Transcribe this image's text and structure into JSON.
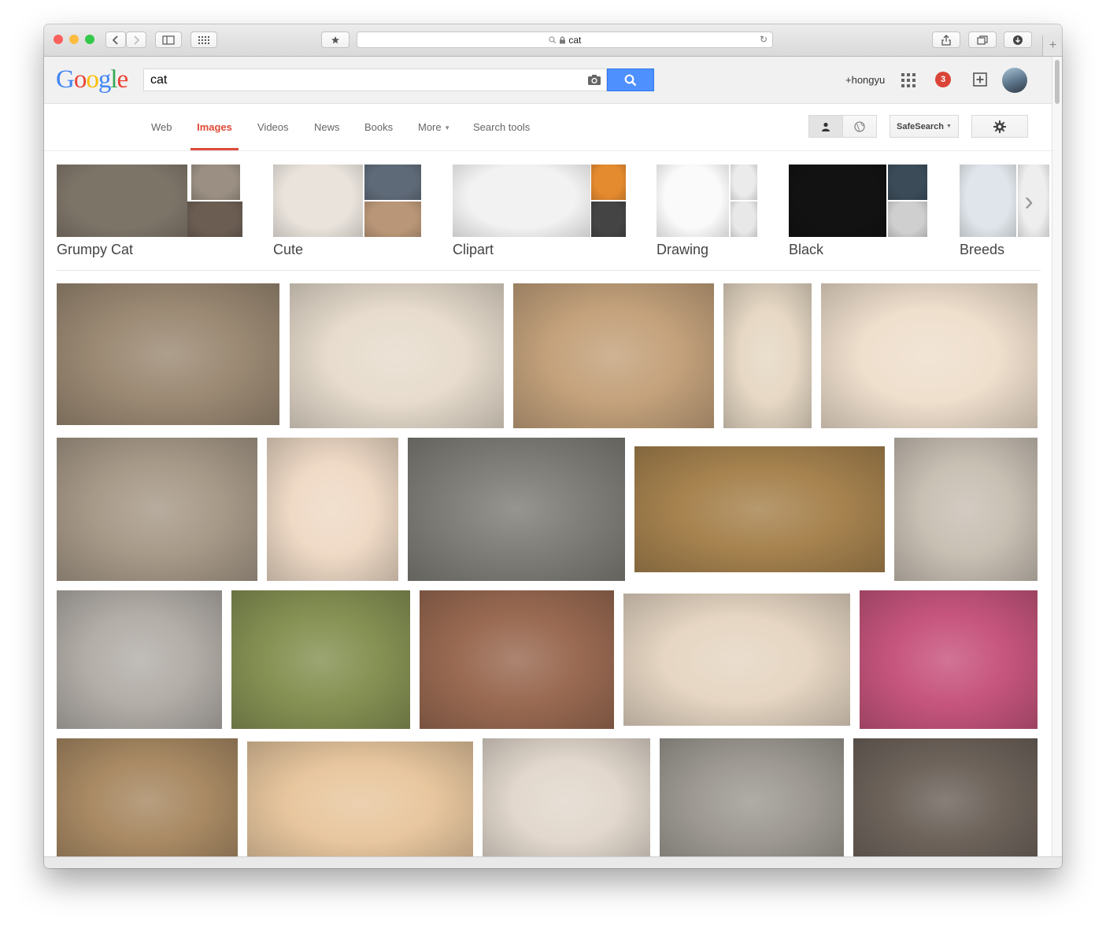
{
  "browser": {
    "url_text": "cat",
    "colors": {
      "close": "#fc605c",
      "minimize": "#fdbc40",
      "zoom": "#34c84a"
    }
  },
  "google": {
    "logo_letters": [
      {
        "ch": "G",
        "color": "#4285f4"
      },
      {
        "ch": "o",
        "color": "#ea4335"
      },
      {
        "ch": "o",
        "color": "#fbbc05"
      },
      {
        "ch": "g",
        "color": "#4285f4"
      },
      {
        "ch": "l",
        "color": "#34a853"
      },
      {
        "ch": "e",
        "color": "#ea4335"
      }
    ],
    "search_value": "cat",
    "user_name": "+hongyu",
    "notification_count": "3",
    "accent": "#dd4b39",
    "button_blue": "#4d90fe"
  },
  "nav": {
    "tabs": [
      {
        "label": "Web",
        "active": false
      },
      {
        "label": "Images",
        "active": true
      },
      {
        "label": "Videos",
        "active": false
      },
      {
        "label": "News",
        "active": false
      },
      {
        "label": "Books",
        "active": false
      },
      {
        "label": "More",
        "active": false
      },
      {
        "label": "Search tools",
        "active": false
      }
    ],
    "safesearch_label": "SafeSearch"
  },
  "related": [
    {
      "label": "Grumpy Cat",
      "colors": [
        "#7d7468",
        "#9a8f82",
        "#6b5d52"
      ]
    },
    {
      "label": "Cute",
      "colors": [
        "#e9e3dc",
        "#5f6a78",
        "#b99677"
      ]
    },
    {
      "label": "Clipart",
      "colors": [
        "#f2f2f2",
        "#e48a2f",
        "#444444"
      ]
    },
    {
      "label": "Drawing",
      "colors": [
        "#fafafa",
        "#ebebeb",
        "#e8e8e8"
      ]
    },
    {
      "label": "Black",
      "colors": [
        "#121212",
        "#3b4b58",
        "#cfcfcf"
      ]
    },
    {
      "label": "Breeds",
      "colors": [
        "#dfe5ea",
        "#eeeeee",
        "#e8e8e8"
      ]
    }
  ],
  "images": [
    {
      "color": "#9c8a74",
      "name": "tabby-cat-lying"
    },
    {
      "color": "#e7dccd",
      "name": "tabby-cat-stretching"
    },
    {
      "color": "#c4a27c",
      "name": "orange-kitten-closeup"
    },
    {
      "color": "#e6d8c4",
      "name": "tabby-kitten-standing"
    },
    {
      "color": "#efdfcd",
      "name": "orange-cat-sitting"
    },
    {
      "color": "#a89a89",
      "name": "longhair-tabby-cat"
    },
    {
      "color": "#efdac6",
      "name": "orange-kitten-waving"
    },
    {
      "color": "#7f7e78",
      "name": "gray-cat-resting"
    },
    {
      "color": "#a7834f",
      "name": "kitten-big-eyes"
    },
    {
      "color": "#c9c0b4",
      "name": "tabby-kitten-portrait"
    },
    {
      "color": "#b3aea8",
      "name": "grumpy-cat-portrait"
    },
    {
      "color": "#869254",
      "name": "kitten-on-grass"
    },
    {
      "color": "#9a6a52",
      "name": "grumpy-cat-lying"
    },
    {
      "color": "#e6d6c3",
      "name": "two-kittens"
    },
    {
      "color": "#c7557d",
      "name": "tabby-cat-pink-background"
    },
    {
      "color": "#a98a64",
      "name": "cat-in-paper-bag"
    },
    {
      "color": "#e8c79f",
      "name": "orange-kitten-playing"
    },
    {
      "color": "#e2d8cd",
      "name": "tabby-kitten-crouching"
    },
    {
      "color": "#9e9a93",
      "name": "wide-eyed-cat"
    },
    {
      "color": "#6d635b",
      "name": "black-white-kitten"
    }
  ]
}
